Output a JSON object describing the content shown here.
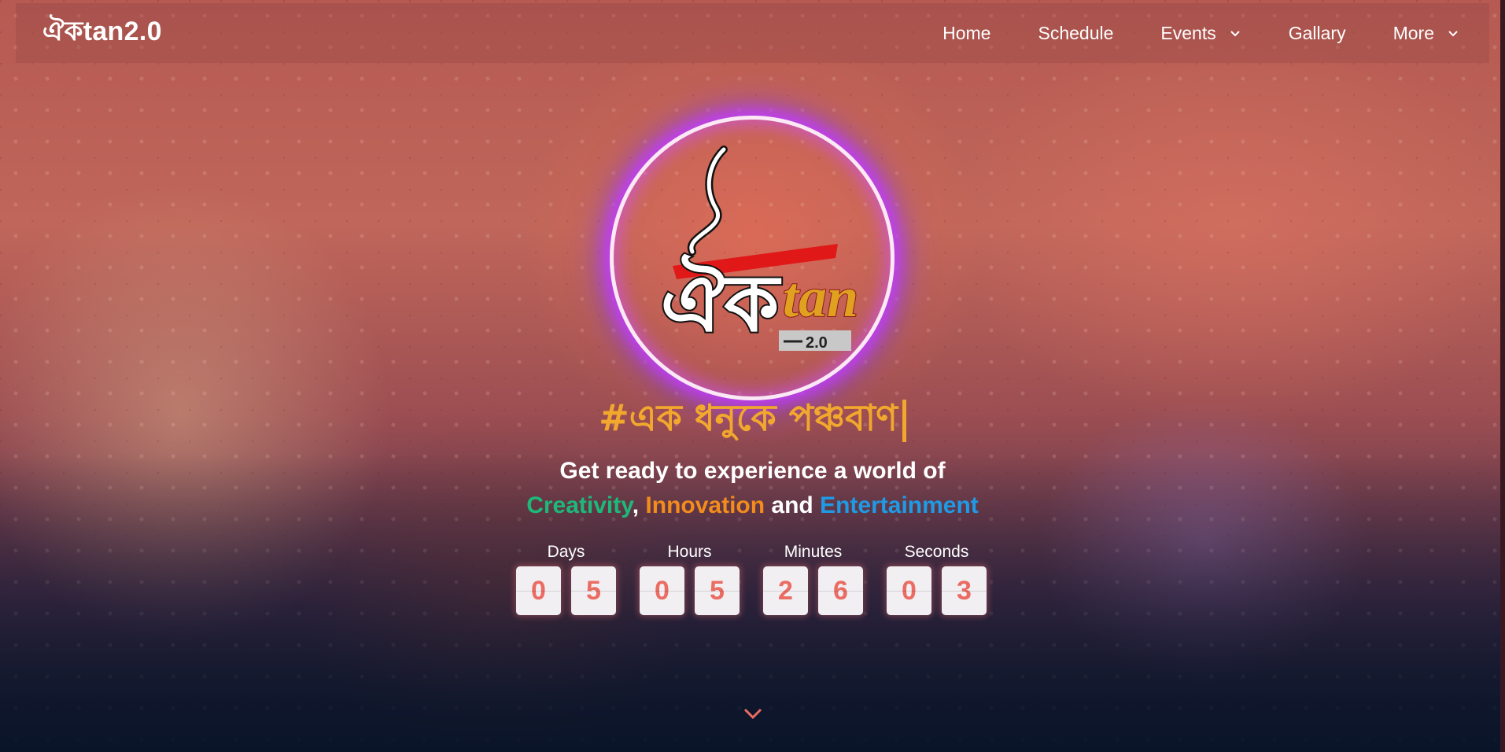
{
  "brand": "ঐকtan2.0",
  "nav": {
    "items": [
      {
        "label": "Home",
        "has_dropdown": false
      },
      {
        "label": "Schedule",
        "has_dropdown": false
      },
      {
        "label": "Events",
        "has_dropdown": true
      },
      {
        "label": "Gallary",
        "has_dropdown": false
      },
      {
        "label": "More",
        "has_dropdown": true
      }
    ]
  },
  "logo": {
    "script_text": "ঐক",
    "latin_text": "tan",
    "version_badge": "2.0"
  },
  "hero": {
    "hashtag": "#এক ধনুকে পঞ্চবাণ",
    "intro_line1": "Get ready to experience a world of",
    "word_creativity": "Creativity",
    "comma": ",",
    "word_innovation": "Innovation",
    "word_and": "and",
    "word_entertainment": "Entertainment"
  },
  "countdown": {
    "days": {
      "label": "Days",
      "d1": "0",
      "d2": "5"
    },
    "hours": {
      "label": "Hours",
      "d1": "0",
      "d2": "5"
    },
    "minutes": {
      "label": "Minutes",
      "d1": "2",
      "d2": "6"
    },
    "seconds": {
      "label": "Seconds",
      "d1": "0",
      "d2": "3"
    }
  },
  "colors": {
    "hashtag": "#f2a82c",
    "creativity": "#1db97a",
    "innovation": "#f28c1c",
    "entertainment": "#1e9be6",
    "digit_text": "#ea6c62",
    "scroll_arrow": "#ea6c62"
  },
  "icons": {
    "dropdown": "chevron-down-icon",
    "scroll": "chevron-down-icon"
  }
}
